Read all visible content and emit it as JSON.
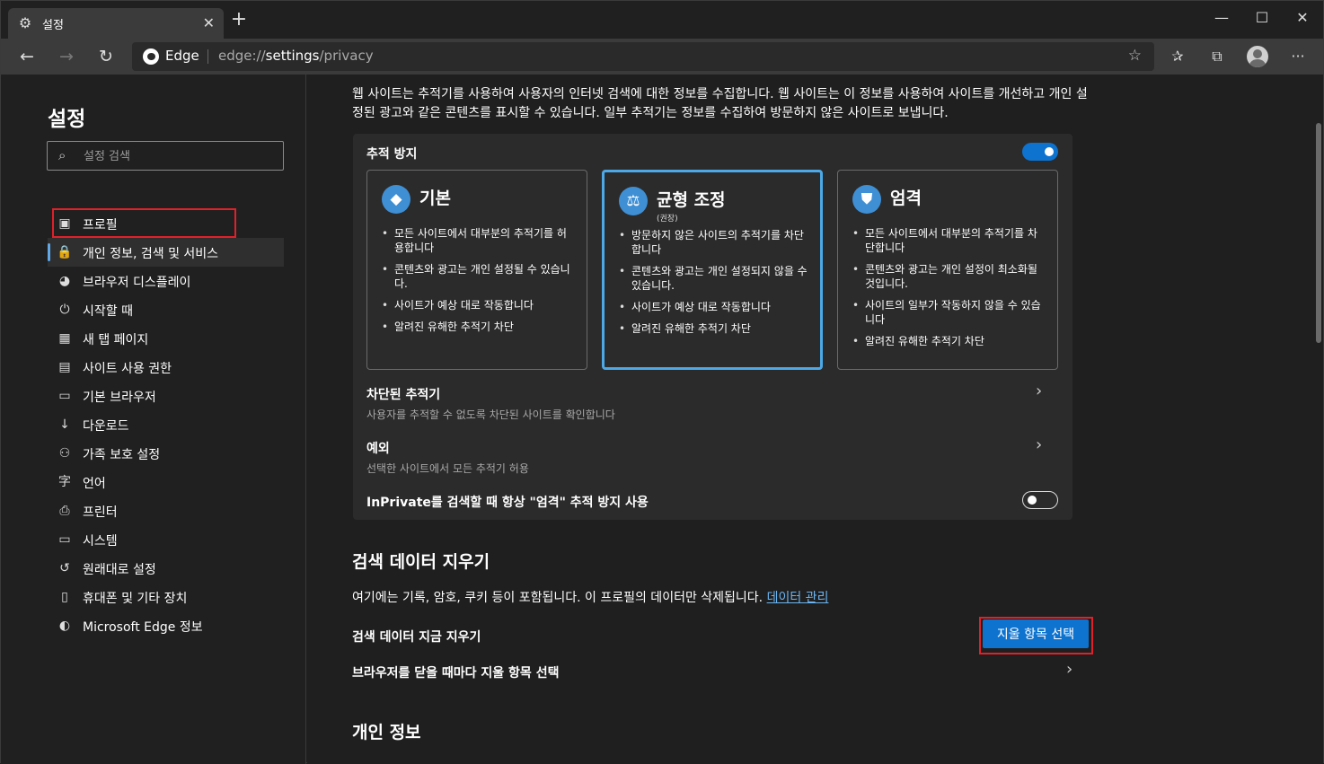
{
  "tab": {
    "title": "설정",
    "close": "✕",
    "new_tab": "+"
  },
  "window_controls": {
    "minimize": "—",
    "maximize": "☐",
    "close": "✕"
  },
  "omnibox": {
    "brand": "Edge",
    "url_scheme": "edge://",
    "url_host": "settings",
    "url_path": "/privacy"
  },
  "sidebar": {
    "title": "설정",
    "search_placeholder": "설정 검색",
    "items": [
      {
        "label": "프로필",
        "icon": "profile-icon",
        "glyph": "▣"
      },
      {
        "label": "개인 정보, 검색 및 서비스",
        "icon": "lock-icon",
        "glyph": "🔒",
        "active": true
      },
      {
        "label": "브라우저 디스플레이",
        "icon": "palette-icon",
        "glyph": "◕"
      },
      {
        "label": "시작할 때",
        "icon": "power-icon",
        "glyph": "⏻"
      },
      {
        "label": "새 탭 페이지",
        "icon": "new-tab-page-icon",
        "glyph": "▦"
      },
      {
        "label": "사이트 사용 권한",
        "icon": "site-permissions-icon",
        "glyph": "▤"
      },
      {
        "label": "기본 브라우저",
        "icon": "default-browser-icon",
        "glyph": "▭"
      },
      {
        "label": "다운로드",
        "icon": "download-icon",
        "glyph": "↓"
      },
      {
        "label": "가족 보호 설정",
        "icon": "family-icon",
        "glyph": "⚇"
      },
      {
        "label": "언어",
        "icon": "language-icon",
        "glyph": "字"
      },
      {
        "label": "프린터",
        "icon": "printer-icon",
        "glyph": "⎙"
      },
      {
        "label": "시스템",
        "icon": "system-icon",
        "glyph": "▭"
      },
      {
        "label": "원래대로 설정",
        "icon": "reset-icon",
        "glyph": "↺"
      },
      {
        "label": "휴대폰 및 기타 장치",
        "icon": "phone-icon",
        "glyph": "▯"
      },
      {
        "label": "Microsoft Edge 정보",
        "icon": "edge-icon",
        "glyph": "◐"
      }
    ]
  },
  "main": {
    "intro": "웹 사이트는 추적기를 사용하여 사용자의 인터넷 검색에 대한 정보를 수집합니다. 웹 사이트는 이 정보를 사용하여 사이트를 개선하고 개인 설정된 광고와 같은 콘텐츠를 표시할 수 있습니다. 일부 추적기는 정보를 수집하여 방문하지 않은 사이트로 보냅니다.",
    "tracking": {
      "title": "추적 방지",
      "enabled": true,
      "options": [
        {
          "name": "기본",
          "subtitle": "",
          "icon": "basic-shapes-icon",
          "glyph": "◆",
          "selected": false,
          "bullets": [
            "모든 사이트에서 대부분의 추적기를 허용합니다",
            "콘텐츠와 광고는 개인 설정될 수 있습니다.",
            "사이트가 예상 대로 작동합니다",
            "알려진 유해한 추적기 차단"
          ]
        },
        {
          "name": "균형 조정",
          "subtitle": "(권장)",
          "icon": "balance-scale-icon",
          "glyph": "⚖",
          "selected": true,
          "bullets": [
            "방문하지 않은 사이트의 추적기를 차단합니다",
            "콘텐츠와 광고는 개인 설정되지 않을 수 있습니다.",
            "사이트가 예상 대로 작동합니다",
            "알려진 유해한 추적기 차단"
          ]
        },
        {
          "name": "엄격",
          "subtitle": "",
          "icon": "shield-icon",
          "glyph": "⛊",
          "selected": false,
          "bullets": [
            "모든 사이트에서 대부분의 추적기를 차단합니다",
            "콘텐츠와 광고는 개인 설정이 최소화될 것입니다.",
            "사이트의 일부가 작동하지 않을 수 있습니다",
            "알려진 유해한 추적기 차단"
          ]
        }
      ],
      "blocked_title": "차단된 추적기",
      "blocked_sub": "사용자를 추적할 수 없도록 차단된 사이트를 확인합니다",
      "exceptions_title": "예외",
      "exceptions_sub": "선택한 사이트에서 모든 추적기 허용",
      "inprivate_label": "InPrivate를 검색할 때 항상 \"엄격\" 추적 방지 사용",
      "inprivate_enabled": false
    },
    "clear": {
      "title": "검색 데이터 지우기",
      "desc": "여기에는 기록, 암호, 쿠키 등이 포함됩니다. 이 프로필의 데이터만 삭제됩니다.",
      "manage_link": "데이터 관리",
      "now_label": "검색 데이터 지금 지우기",
      "button": "지울 항목 선택",
      "on_close_label": "브라우저를 닫을 때마다 지울 항목 선택"
    },
    "personal_title": "개인 정보"
  }
}
